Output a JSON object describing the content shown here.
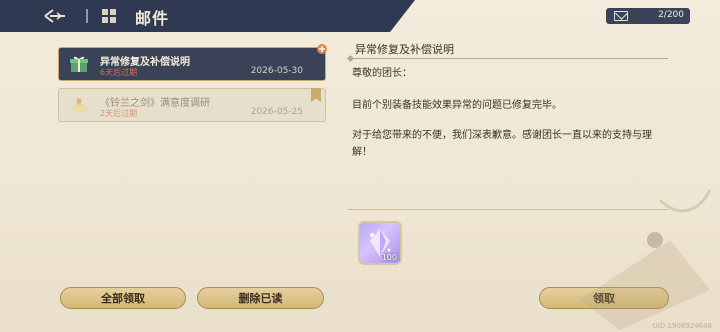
{
  "header": {
    "title": "邮件",
    "mail_count": "2/200"
  },
  "mails": [
    {
      "subject": "异常修复及补偿说明",
      "expire": "6天后过期",
      "date": "2026-05-30",
      "state": "unread"
    },
    {
      "subject": "《铃兰之剑》满意度调研",
      "expire": "2天后过期",
      "date": "2026-05-25",
      "state": "read"
    }
  ],
  "buttons": {
    "claim_all": "全部领取",
    "delete_read": "删除已读",
    "claim": "领取"
  },
  "detail": {
    "title": "异常修复及补偿说明",
    "greeting": "尊敬的团长：",
    "paragraph1": "目前个别装备技能效果异常的问题已修复完毕。",
    "paragraph2": "对于给您带来的不便，我们深表歉意。感谢团长一直以来的支持与理解！",
    "reward_qty": "100"
  },
  "footer": {
    "uid": "UID 1908924648"
  },
  "colors": {
    "header_bg": "#2f3a52",
    "accent_gold": "#c7a968",
    "expire_red": "#e06d4c"
  }
}
